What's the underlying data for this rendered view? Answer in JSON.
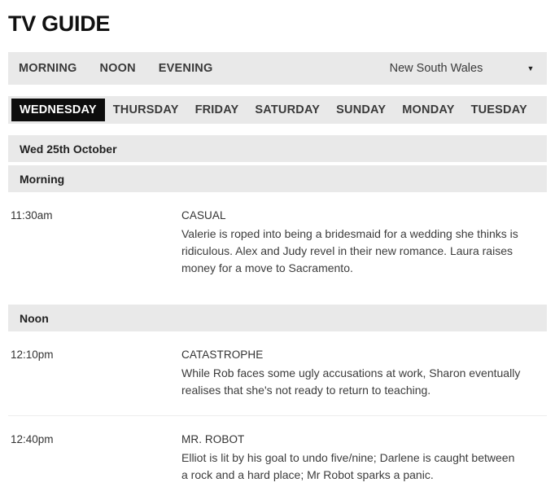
{
  "header": {
    "title": "TV GUIDE"
  },
  "topbar": {
    "daypart_nav": [
      {
        "label": "MORNING"
      },
      {
        "label": "NOON"
      },
      {
        "label": "EVENING"
      }
    ],
    "region_select": {
      "selected": "New South Wales",
      "chevron": "▼",
      "icon_name": "chevron-down-icon"
    }
  },
  "day_tabs": [
    {
      "label": "WEDNESDAY",
      "active": true
    },
    {
      "label": "THURSDAY",
      "active": false
    },
    {
      "label": "FRIDAY",
      "active": false
    },
    {
      "label": "SATURDAY",
      "active": false
    },
    {
      "label": "SUNDAY",
      "active": false
    },
    {
      "label": "MONDAY",
      "active": false
    },
    {
      "label": "TUESDAY",
      "active": false
    }
  ],
  "date_header": "Wed 25th October",
  "sections": [
    {
      "heading": "Morning",
      "listings": [
        {
          "time": "11:30am",
          "title": "CASUAL",
          "description": "Valerie is roped into being a bridesmaid for a wedding she thinks is ridiculous. Alex and Judy revel in their new romance. Laura raises money for a move to Sacramento."
        }
      ]
    },
    {
      "heading": "Noon",
      "listings": [
        {
          "time": "12:10pm",
          "title": "CATASTROPHE",
          "description": "While Rob faces some ugly accusations at work, Sharon eventually realises that she's not ready to return to teaching."
        },
        {
          "time": "12:40pm",
          "title": "MR. ROBOT",
          "description": "Elliot is lit by his goal to undo five/nine; Darlene is caught between a rock and a hard place; Mr Robot sparks a panic."
        }
      ]
    }
  ],
  "colors": {
    "bar_gray": "#e9e9e9",
    "active_tab_bg": "#0d0d0d",
    "active_tab_text": "#ffffff",
    "text": "#333333",
    "divider": "#ededed"
  }
}
